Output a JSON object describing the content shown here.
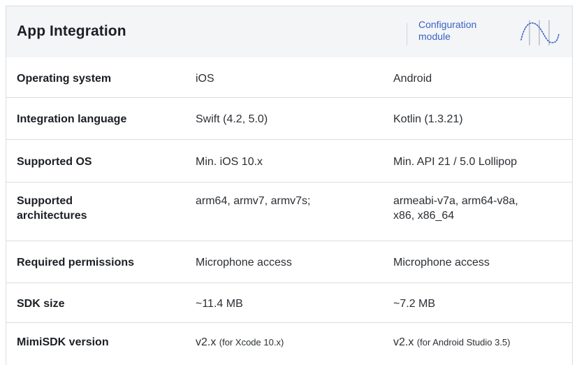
{
  "header": {
    "title": "App Integration",
    "module_line1": "Configuration",
    "module_line2": "module",
    "logo_icon": "waveform-logo-icon"
  },
  "rows": [
    {
      "label": "Operating system",
      "ios": "iOS",
      "android": "Android"
    },
    {
      "label": "Integration language",
      "ios": "Swift (4.2, 5.0)",
      "android": "Kotlin (1.3.21)"
    },
    {
      "label": "Supported OS",
      "ios": "Min. iOS 10.x",
      "android": "Min. API 21 / 5.0 Lollipop"
    },
    {
      "label_line1": "Supported",
      "label_line2": "architectures",
      "ios": "arm64, armv7, armv7s;",
      "android_line1": "armeabi-v7a, arm64-v8a,",
      "android_line2": "x86, x86_64"
    },
    {
      "label": "Required permissions",
      "ios": "Microphone access",
      "android": "Microphone access"
    },
    {
      "label": "SDK size",
      "ios": "~11.4 MB",
      "android": "~7.2 MB"
    },
    {
      "label": "MimiSDK version",
      "ios_main": "v2.x",
      "ios_note": "(for Xcode 10.x)",
      "android_main": "v2.x",
      "android_note": "(for Android Studio 3.5)"
    }
  ],
  "colors": {
    "accent": "#3a63c4",
    "header_bg": "#f3f5f7",
    "divider": "#d9dde2"
  }
}
